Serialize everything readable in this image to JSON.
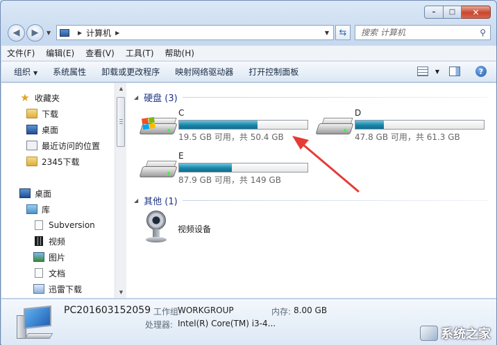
{
  "titlebar": {
    "minimize": "–",
    "maximize": "□",
    "close": "✕"
  },
  "address": {
    "path": "计算机"
  },
  "search": {
    "placeholder": "搜索 计算机"
  },
  "menu": [
    "文件(F)",
    "编辑(E)",
    "查看(V)",
    "工具(T)",
    "帮助(H)"
  ],
  "toolbar": {
    "organize": "组织",
    "system_properties": "系统属性",
    "uninstall": "卸载或更改程序",
    "map_drive": "映射网络驱动器",
    "control_panel": "打开控制面板"
  },
  "sidebar": {
    "favorites": "收藏夹",
    "items": [
      "下载",
      "桌面",
      "最近访问的位置",
      "2345下载"
    ],
    "desktop": "桌面",
    "library": "库",
    "lib_items": [
      "Subversion",
      "视频",
      "图片",
      "文档",
      "迅雷下载"
    ]
  },
  "groups": {
    "hard_disks": "硬盘 (3)",
    "other": "其他 (1)"
  },
  "drives": [
    {
      "label": "C",
      "free_text": "19.5 GB 可用，共 50.4 GB",
      "used_fraction": 0.613
    },
    {
      "label": "D",
      "free_text": "47.8 GB 可用，共 61.3 GB",
      "used_fraction": 0.22
    },
    {
      "label": "E",
      "free_text": "87.9 GB 可用，共 149 GB",
      "used_fraction": 0.41
    }
  ],
  "other_device": "视频设备",
  "details": {
    "pc_name": "PC201603152059",
    "workgroup_label": "工作组:",
    "workgroup": "WORKGROUP",
    "memory_label": "内存:",
    "memory": "8.00 GB",
    "cpu_label": "处理器:",
    "cpu": "Intel(R) Core(TM) i3-4..."
  },
  "watermark": "系统之家",
  "colors": {
    "bar": "#1a84a8",
    "group_header": "#1e3287",
    "annotation_arrow": "#e53b35"
  }
}
